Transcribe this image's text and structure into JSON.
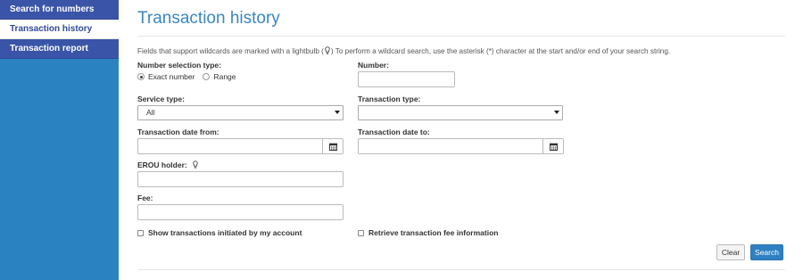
{
  "sidebar": {
    "items": [
      {
        "label": "Search for numbers"
      },
      {
        "label": "Transaction history"
      },
      {
        "label": "Transaction report"
      }
    ]
  },
  "main": {
    "title": "Transaction history",
    "intro_before": "Fields that support wildcards are marked with a lightbulb (",
    "intro_after": ") To perform a wildcard search, use the asterisk (*) character at the start and/or end of your search string."
  },
  "form": {
    "number_selection_label": "Number selection type:",
    "radio_exact": "Exact number",
    "radio_range": "Range",
    "number_label": "Number:",
    "number_value": "",
    "service_type_label": "Service type:",
    "service_type_value": "All",
    "transaction_type_label": "Transaction type:",
    "transaction_type_value": "",
    "date_from_label": "Transaction date from:",
    "date_from_value": "",
    "date_to_label": "Transaction date to:",
    "date_to_value": "",
    "erou_label": "EROU holder:",
    "erou_value": "",
    "fee_label": "Fee:",
    "fee_value": "",
    "check_my_account": "Show transactions initiated by my account",
    "check_fee_info": "Retrieve transaction fee information"
  },
  "buttons": {
    "clear": "Clear",
    "search": "Search"
  },
  "colors": {
    "sidebar_bg": "#2a83c0",
    "nav_item_bg": "#3a55a8",
    "title": "#3a87c2",
    "primary_button": "#2f80c2"
  },
  "icons": {
    "wildcard": "lightbulb-icon",
    "date_picker": "calendar-icon",
    "dropdown": "caret-down-icon"
  }
}
